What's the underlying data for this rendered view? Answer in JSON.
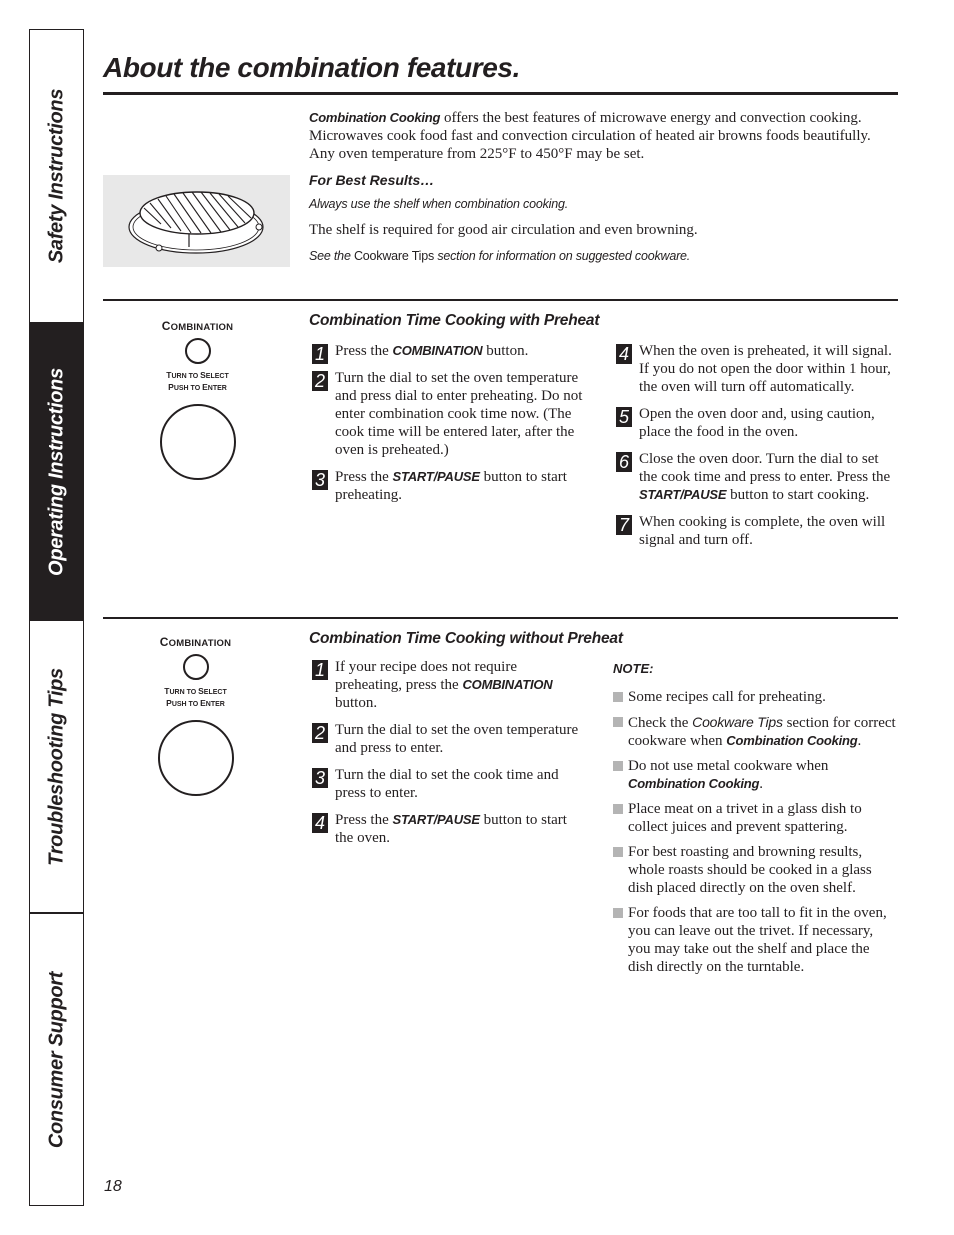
{
  "side_tabs": [
    {
      "label": "Safety Instructions",
      "active": false
    },
    {
      "label": "Operating Instructions",
      "active": true
    },
    {
      "label": "Troubleshooting Tips",
      "active": false
    },
    {
      "label": "Consumer Support",
      "active": false
    }
  ],
  "header": {
    "title": "About the combination features."
  },
  "intro": {
    "image_alt": "oven-shelf-illustration",
    "lead_bold": "Combination Cooking",
    "lead_rest": " offers the best features of microwave energy and convection cooking. Microwaves cook food fast and convection circulation of heated air browns foods beautifully. Any oven temperature from 225°F to 450°F may be set.",
    "best_results_heading": "For Best Results…",
    "always_use": "Always use the shelf when combination cooking.",
    "shelf_required": "The shelf is required for good air circulation and even browning.",
    "see_prefix": "See the ",
    "see_link": "Cookware Tips",
    "see_suffix": " section for information on suggested cookware."
  },
  "control_panel": {
    "button_label_first": "C",
    "button_label_rest": "OMBINATION",
    "dial_label_line1_a": "T",
    "dial_label_line1_b": "URN TO ",
    "dial_label_line1_c": "S",
    "dial_label_line1_d": "ELECT",
    "dial_label_line2_a": "P",
    "dial_label_line2_b": "USH TO ",
    "dial_label_line2_c": "E",
    "dial_label_line2_d": "NTER"
  },
  "with_preheat": {
    "heading": "Combination Time Cooking with Preheat",
    "steps": [
      {
        "num": "1",
        "pre": "Press the ",
        "bold": "COMBINATION",
        "post": " button."
      },
      {
        "num": "2",
        "pre": "Turn the dial to set the oven temperature and press dial to enter preheating. Do not enter combination cook time now. (The cook time will be entered later, after the oven is preheated.)",
        "bold": "",
        "post": ""
      },
      {
        "num": "3",
        "pre": "Press the ",
        "bold": "START/PAUSE",
        "post": " button to start preheating."
      },
      {
        "num": "4",
        "pre": "When the oven is preheated, it will signal. If you do not open the door within 1 hour, the oven will turn off automatically.",
        "bold": "",
        "post": ""
      },
      {
        "num": "5",
        "pre": "Open the oven door and, using caution, place the food in the oven.",
        "bold": "",
        "post": ""
      },
      {
        "num": "6",
        "pre": "Close the oven door. Turn the dial to set the cook time and press to enter. Press the ",
        "bold": "START/PAUSE",
        "post": " button to start cooking."
      },
      {
        "num": "7",
        "pre": "When cooking is complete, the oven will signal and turn off.",
        "bold": "",
        "post": ""
      }
    ]
  },
  "without_preheat": {
    "heading": "Combination Time Cooking without Preheat",
    "steps": [
      {
        "num": "1",
        "pre": "If your recipe does not require preheating, press the ",
        "bold": "COMBINATION",
        "post": " button."
      },
      {
        "num": "2",
        "pre": "Turn the dial to set the oven temperature and press to enter.",
        "bold": "",
        "post": ""
      },
      {
        "num": "3",
        "pre": "Turn the dial to set the cook time and press to enter.",
        "bold": "",
        "post": ""
      },
      {
        "num": "4",
        "pre": "Press the ",
        "bold": "START/PAUSE",
        "post": " button to start the oven."
      }
    ],
    "note": {
      "title": "NOTE:",
      "bullets": [
        {
          "pre": "Some recipes call for preheating.",
          "italic": "",
          "mid": "",
          "bold": "",
          "post": ""
        },
        {
          "pre": "Check the ",
          "italic": "Cookware Tips",
          "mid": " section for correct cookware when ",
          "bold": "Combination Cooking",
          "post": "."
        },
        {
          "pre": "Do not use metal cookware when ",
          "italic": "",
          "mid": "",
          "bold": "Combination Cooking",
          "post": "."
        },
        {
          "pre": "Place meat on a trivet in a glass dish to collect juices and prevent spattering.",
          "italic": "",
          "mid": "",
          "bold": "",
          "post": ""
        },
        {
          "pre": "For best roasting and browning results, whole roasts should be cooked in a glass dish placed directly on the oven shelf.",
          "italic": "",
          "mid": "",
          "bold": "",
          "post": ""
        },
        {
          "pre": "For foods that are too tall to fit in the oven, you can leave out the trivet. If necessary, you may take out the shelf and place the dish directly on the turntable.",
          "italic": "",
          "mid": "",
          "bold": "",
          "post": ""
        }
      ]
    }
  },
  "footer": {
    "page_number": "18"
  }
}
